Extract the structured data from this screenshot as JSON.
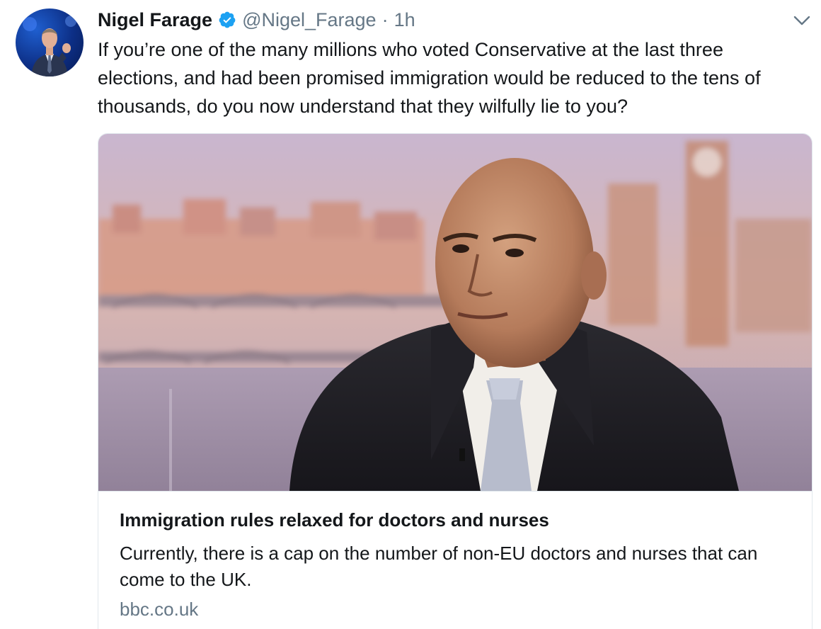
{
  "tweet": {
    "author_name": "Nigel Farage",
    "handle": "@Nigel_Farage",
    "separator": "·",
    "time": "1h",
    "verified_icon": "verified-badge-icon",
    "more_icon": "chevron-down-icon",
    "text": "If you’re one of the many millions who voted Conservative at the last three\nelections, and had been promised immigration would be reduced to the tens of\nthousands, do you now understand that they wilfully lie to you?"
  },
  "card": {
    "title": "Immigration rules relaxed for doctors and nurses",
    "description": "Currently, there is a cap on the number of non-EU doctors and nurses that can come to the UK.",
    "domain": "bbc.co.uk"
  },
  "colors": {
    "text": "#14171a",
    "secondary": "#657786",
    "verified": "#1da1f2",
    "border": "#e1e8ed"
  }
}
